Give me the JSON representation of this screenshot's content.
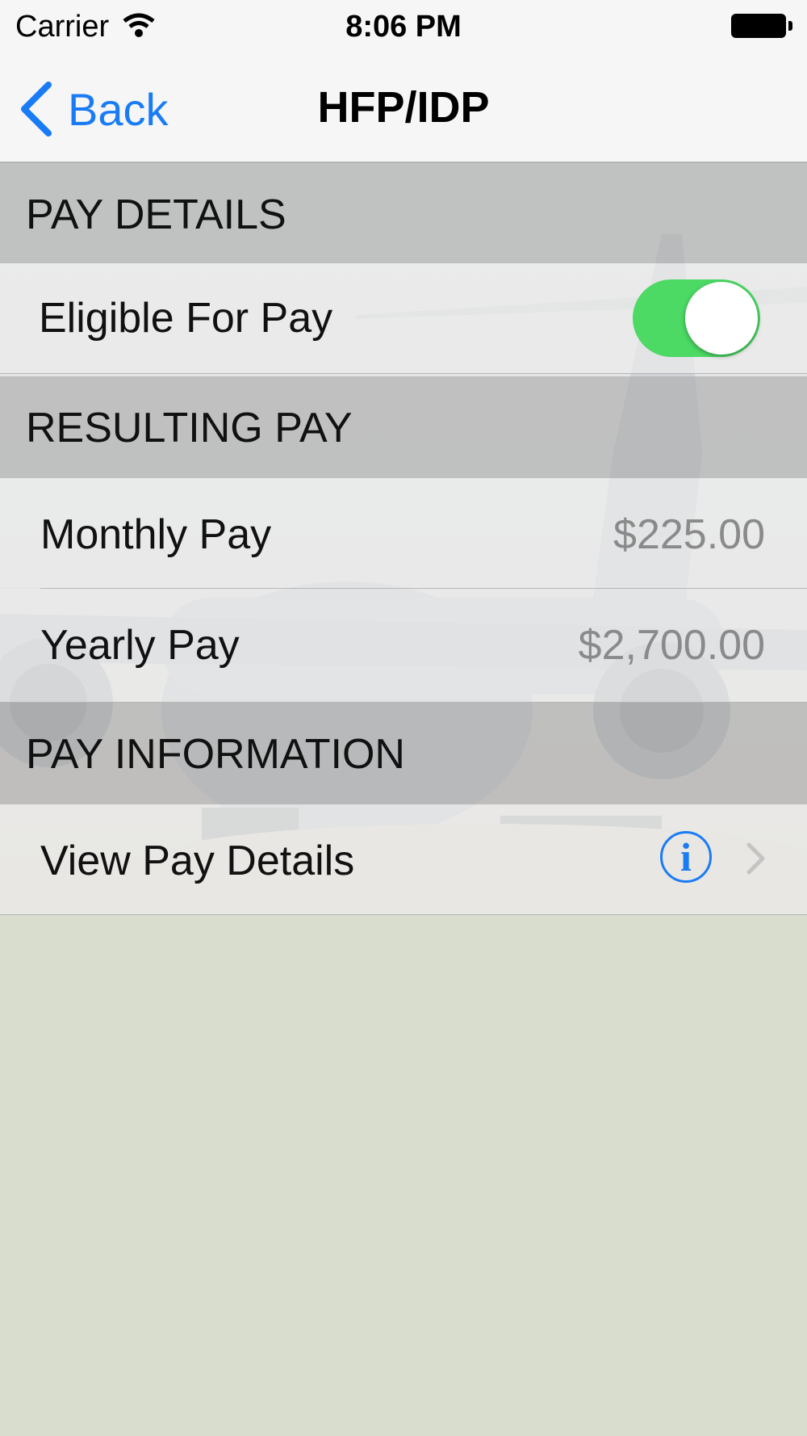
{
  "status_bar": {
    "carrier": "Carrier",
    "time": "8:06 PM"
  },
  "nav": {
    "back_label": "Back",
    "title": "HFP/IDP"
  },
  "sections": {
    "pay_details": {
      "header": "PAY DETAILS",
      "eligible_label": "Eligible For Pay",
      "eligible_on": true
    },
    "resulting_pay": {
      "header": "RESULTING PAY",
      "monthly_label": "Monthly Pay",
      "monthly_value": "$225.00",
      "yearly_label": "Yearly Pay",
      "yearly_value": "$2,700.00"
    },
    "pay_information": {
      "header": "PAY INFORMATION",
      "view_label": "View Pay Details"
    }
  },
  "colors": {
    "accent": "#1a7cf5",
    "toggle_on": "#4cd964"
  },
  "icons": [
    "wifi-icon",
    "battery-icon",
    "back-chevron-icon",
    "info-icon",
    "chevron-right-icon"
  ]
}
